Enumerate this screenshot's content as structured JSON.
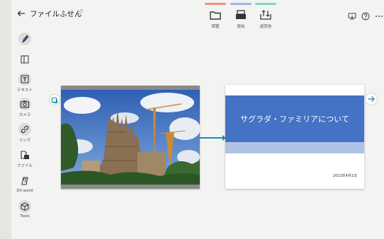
{
  "header": {
    "title": "ファイルふせん",
    "toolbar": [
      {
        "label": "保管",
        "color": "#f28b82"
      },
      {
        "label": "提出",
        "color": "#9ab7e8"
      },
      {
        "label": "送受信",
        "color": "#81d4c8"
      }
    ]
  },
  "left_tools": [
    {
      "label": ""
    },
    {
      "label": ""
    },
    {
      "label": "テキスト"
    },
    {
      "label": "カメラ"
    },
    {
      "label": "リンク"
    },
    {
      "label": "ファイル"
    },
    {
      "label": "EX-word"
    },
    {
      "label": "Tools"
    }
  ],
  "slide": {
    "title": "サグラダ・ファミリアについて",
    "date": "2022年4月1日"
  },
  "colors": {
    "accent": "#1a8fa3",
    "slide_band": "#4472c4"
  }
}
